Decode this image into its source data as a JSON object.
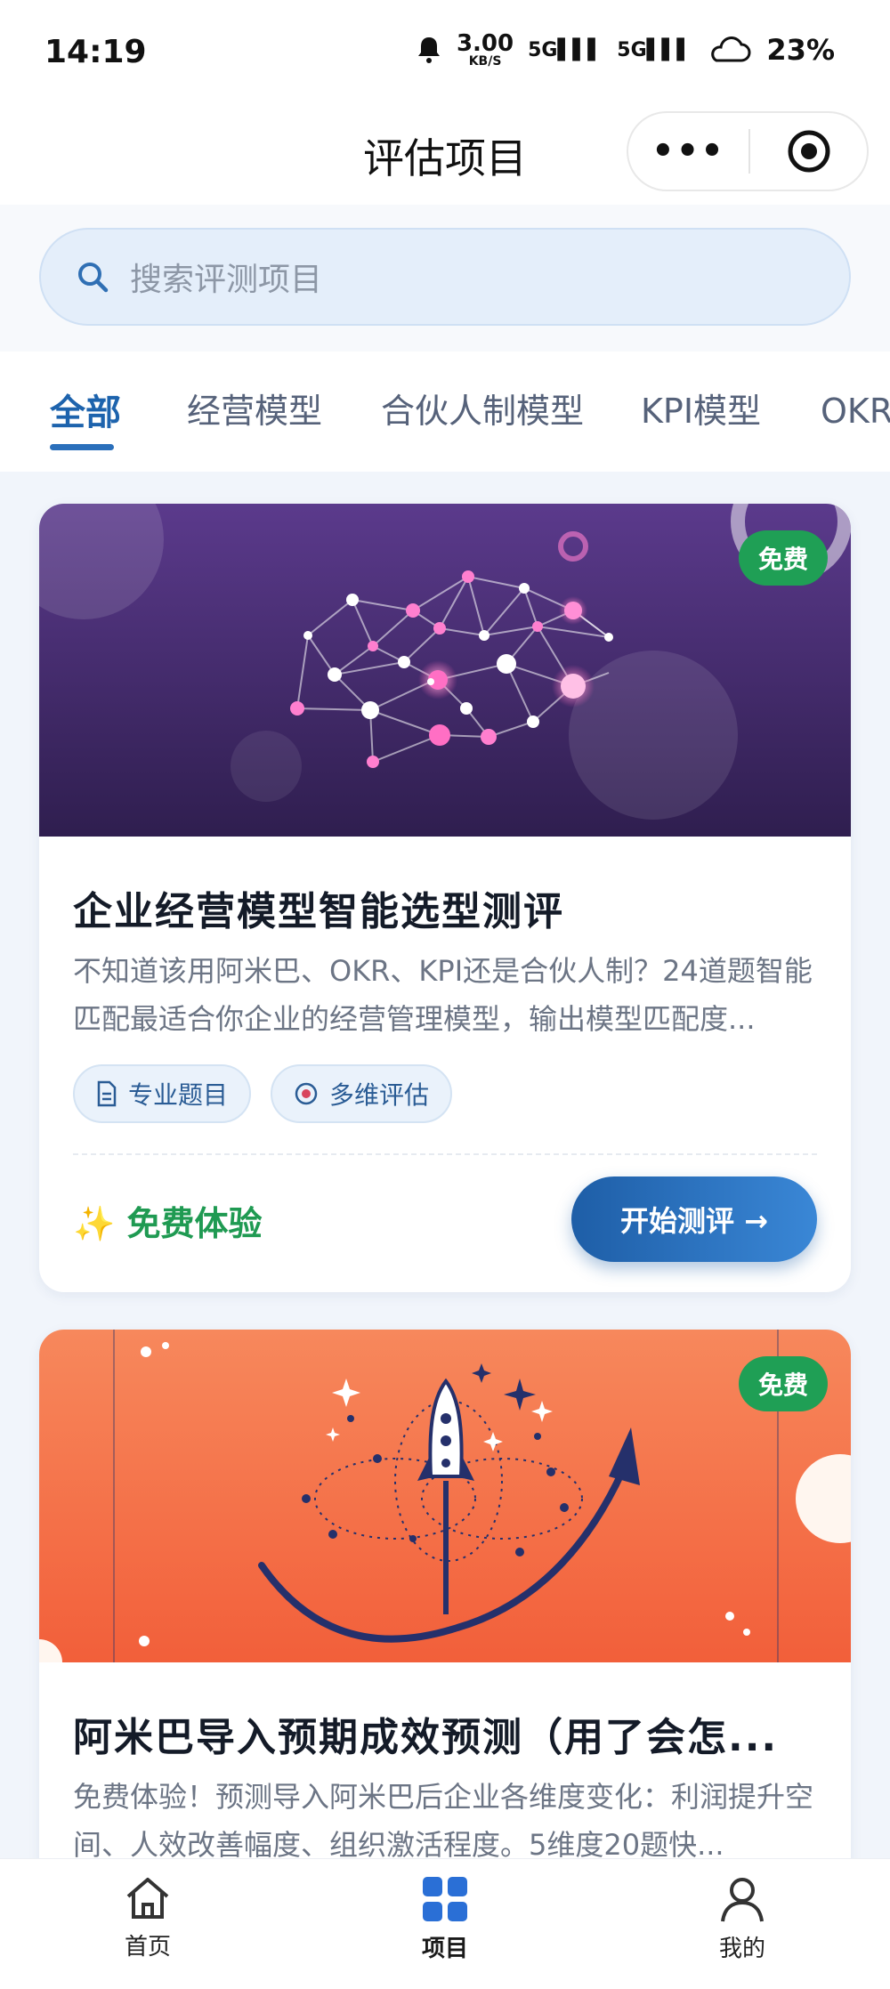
{
  "status_bar": {
    "time": "14:19",
    "speed_value": "3.00",
    "speed_unit": "KB/S",
    "signal1": "5G",
    "signal2": "5G",
    "battery": "23%",
    "icons": [
      "bell-icon",
      "signal-icon",
      "cloud-icon"
    ]
  },
  "nav": {
    "title": "评估项目",
    "more_label": "•••"
  },
  "search": {
    "placeholder": "搜索评测项目"
  },
  "tabs": [
    {
      "label": "全部",
      "active": true
    },
    {
      "label": "经营模型",
      "active": false
    },
    {
      "label": "合伙人制模型",
      "active": false
    },
    {
      "label": "KPI模型",
      "active": false
    },
    {
      "label": "OKR模型",
      "active": false
    }
  ],
  "cards": [
    {
      "badge": "免费",
      "title": "企业经营模型智能选型测评",
      "description": "不知道该用阿米巴、OKR、KPI还是合伙人制？24道题智能匹配最适合你企业的经营管理模型，输出模型匹配度...",
      "chips": [
        {
          "label": "专业题目",
          "icon": "document-icon"
        },
        {
          "label": "多维评估",
          "icon": "target-icon"
        }
      ],
      "free_text": "✨ 免费体验",
      "button": "开始测评 →",
      "colors": {
        "banner": "#4a2f6e"
      }
    },
    {
      "badge": "免费",
      "title": "阿米巴导入预期成效预测（用了会怎...",
      "description": "免费体验！预测导入阿米巴后企业各维度变化：利润提升空间、人效改善幅度、组织激活程度。5维度20题快...",
      "colors": {
        "banner": "#f26d45"
      }
    }
  ],
  "bottom_tabs": [
    {
      "label": "首页",
      "icon": "home-icon",
      "active": false
    },
    {
      "label": "项目",
      "icon": "grid-icon",
      "active": true
    },
    {
      "label": "我的",
      "icon": "user-icon",
      "active": false
    }
  ],
  "colors": {
    "accent": "#1d63ad",
    "free_green": "#1f9f55",
    "page_bg": "#f1f5fb"
  }
}
